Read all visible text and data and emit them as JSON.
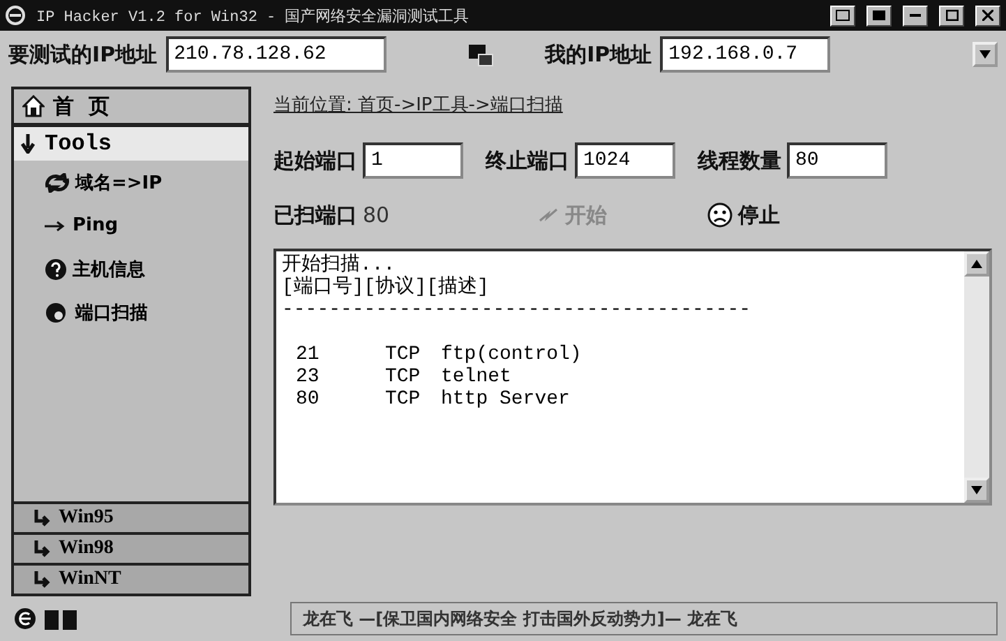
{
  "window": {
    "title": "IP Hacker V1.2 for Win32 - 国产网络安全漏洞测试工具"
  },
  "target": {
    "label": "要测试的IP地址",
    "value": "210.78.128.62"
  },
  "local": {
    "label": "我的IP地址",
    "value": "192.168.0.7"
  },
  "sidebar": {
    "home": "首  页",
    "section": {
      "label": "Tools",
      "expanded": true
    },
    "items": [
      {
        "kind": "swap",
        "label": "域名=>IP"
      },
      {
        "kind": "arrow",
        "label": "Ping"
      },
      {
        "kind": "help",
        "label": "主机信息"
      },
      {
        "kind": "scan",
        "label": "端口扫描"
      }
    ],
    "buttons": [
      "Win95",
      "Win98",
      "WinNT"
    ]
  },
  "breadcrumb": "当前位置: 首页->IP工具->端口扫描",
  "fields": [
    {
      "label": "起始端口",
      "value": "1"
    },
    {
      "label": "终止端口",
      "value": "1024"
    },
    {
      "label": "线程数量",
      "value": "80"
    }
  ],
  "scanned": {
    "label": "已扫端口",
    "value": "80"
  },
  "actions": [
    {
      "kind": "start",
      "label": "开始",
      "disabled": true
    },
    {
      "kind": "stop",
      "label": "停止",
      "disabled": false
    }
  ],
  "output": {
    "lines": [
      "开始扫描...",
      "[端口号][协议][描述]",
      "----------------------------------------"
    ],
    "rows": [
      {
        "port": "21",
        "protocol": "TCP",
        "description": "ftp(control)"
      },
      {
        "port": "23",
        "protocol": "TCP",
        "description": "telnet"
      },
      {
        "port": "80",
        "protocol": "TCP",
        "description": "http Server"
      }
    ]
  },
  "status_bar": {
    "marquee": "龙在飞 —[保卫国内网络安全 打击国外反动势力]— 龙在飞"
  }
}
